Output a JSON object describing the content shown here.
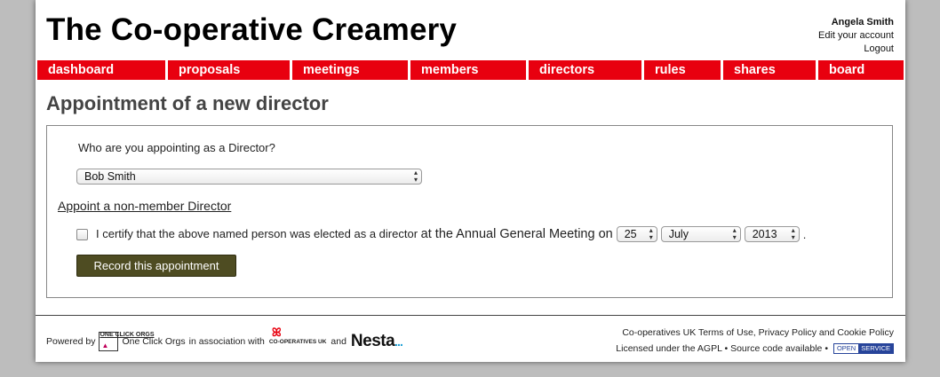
{
  "header": {
    "title": "The Co-operative Creamery",
    "user_name": "Angela Smith",
    "edit_account": "Edit your account",
    "logout": "Logout"
  },
  "nav": {
    "items": [
      {
        "label": "dashboard"
      },
      {
        "label": "proposals"
      },
      {
        "label": "meetings"
      },
      {
        "label": "members"
      },
      {
        "label": "directors"
      },
      {
        "label": "rules"
      },
      {
        "label": "shares"
      },
      {
        "label": "board"
      }
    ]
  },
  "main": {
    "heading": "Appointment of a new director",
    "question": "Who are you appointing as a Director?",
    "director_selected": "Bob Smith",
    "nonmember_link": "Appoint a non-member Director",
    "certify_prefix": "I certify that the above named person was elected as a director",
    "certify_suffix": "at the Annual General Meeting on",
    "day_selected": "25",
    "month_selected": "July",
    "year_selected": "2013",
    "period": ".",
    "certify_checked": false,
    "record_button": "Record this appointment"
  },
  "footer": {
    "powered_by": "Powered by",
    "oco_logo_text": "ONE CLICK ORGS",
    "oco_name": "One Click Orgs",
    "association": "in association with",
    "coop_logo": "CO-OPERATIVES UK",
    "and": "and",
    "nesta": "Nesta",
    "terms_prefix": "Co-operatives UK",
    "terms_link": "Terms of Use",
    "privacy_link": "Privacy Policy",
    "terms_and": "and",
    "cookie_link": "Cookie Policy",
    "license": "Licensed under the AGPL",
    "source_code": "Source code available",
    "bullet": "•",
    "badge_left": "OPEN",
    "badge_right": "SERVICE"
  },
  "colors": {
    "nav_red": "#e8000f",
    "button_olive": "#4e4c22",
    "badge_blue": "#27449a"
  }
}
